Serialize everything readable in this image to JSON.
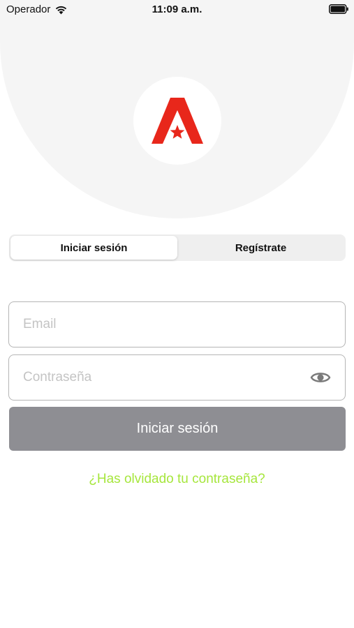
{
  "status_bar": {
    "carrier": "Operador",
    "time": "11:09 a.m.",
    "icons": [
      "wifi-icon",
      "battery-icon"
    ]
  },
  "logo": {
    "icon": "red-a-star-logo",
    "color": "#e8271b"
  },
  "tabs": [
    {
      "label": "Iniciar sesión",
      "active": true
    },
    {
      "label": "Regístrate",
      "active": false
    }
  ],
  "form": {
    "email": {
      "placeholder": "Email",
      "value": ""
    },
    "password": {
      "placeholder": "Contraseña",
      "value": "",
      "toggle_icon": "eye-icon"
    },
    "submit_label": "Iniciar sesión",
    "forgot_label": "¿Has olvidado tu contraseña?"
  },
  "colors": {
    "accent": "#a6e63c",
    "button_disabled": "#8e8e93",
    "brand": "#e8271b"
  }
}
